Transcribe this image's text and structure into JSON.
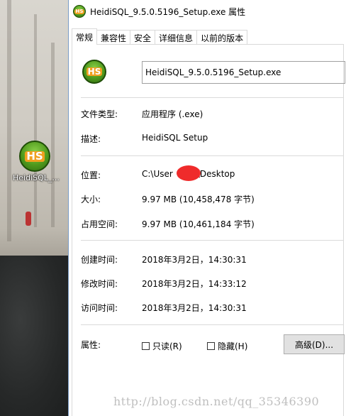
{
  "desktop": {
    "icon_label": "HeidiSQL_...",
    "icon_text": "HS"
  },
  "window": {
    "title": "HeidiSQL_9.5.0.5196_Setup.exe 属性",
    "icon_text": "HS"
  },
  "tabs": [
    {
      "label": "常规",
      "active": true
    },
    {
      "label": "兼容性"
    },
    {
      "label": "安全"
    },
    {
      "label": "详细信息"
    },
    {
      "label": "以前的版本"
    }
  ],
  "general": {
    "icon_text": "HS",
    "file_name": "HeidiSQL_9.5.0.5196_Setup.exe",
    "file_type_label": "文件类型:",
    "file_type_value": "应用程序 (.exe)",
    "description_label": "描述:",
    "description_value": "HeidiSQL Setup",
    "location_label": "位置:",
    "location_value_prefix": "C:\\User",
    "location_value_suffix": "\\Desktop",
    "size_label": "大小:",
    "size_value": "9.97 MB (10,458,478 字节)",
    "disk_size_label": "占用空间:",
    "disk_size_value": "9.97 MB (10,461,184 字节)",
    "created_label": "创建时间:",
    "created_value": "2018年3月2日，14:30:31",
    "modified_label": "修改时间:",
    "modified_value": "2018年3月2日，14:33:12",
    "accessed_label": "访问时间:",
    "accessed_value": "2018年3月2日，14:30:31",
    "attributes_label": "属性:",
    "readonly_label": "只读(R)",
    "readonly_checked": false,
    "hidden_label": "隐藏(H)",
    "hidden_checked": false,
    "advanced_button": "高级(D)..."
  },
  "watermark": "http://blog.csdn.net/qq_35346390",
  "colors": {
    "redaction": "#ef2b2b",
    "window_border": "#7a9cc6",
    "separator": "#dadada"
  }
}
